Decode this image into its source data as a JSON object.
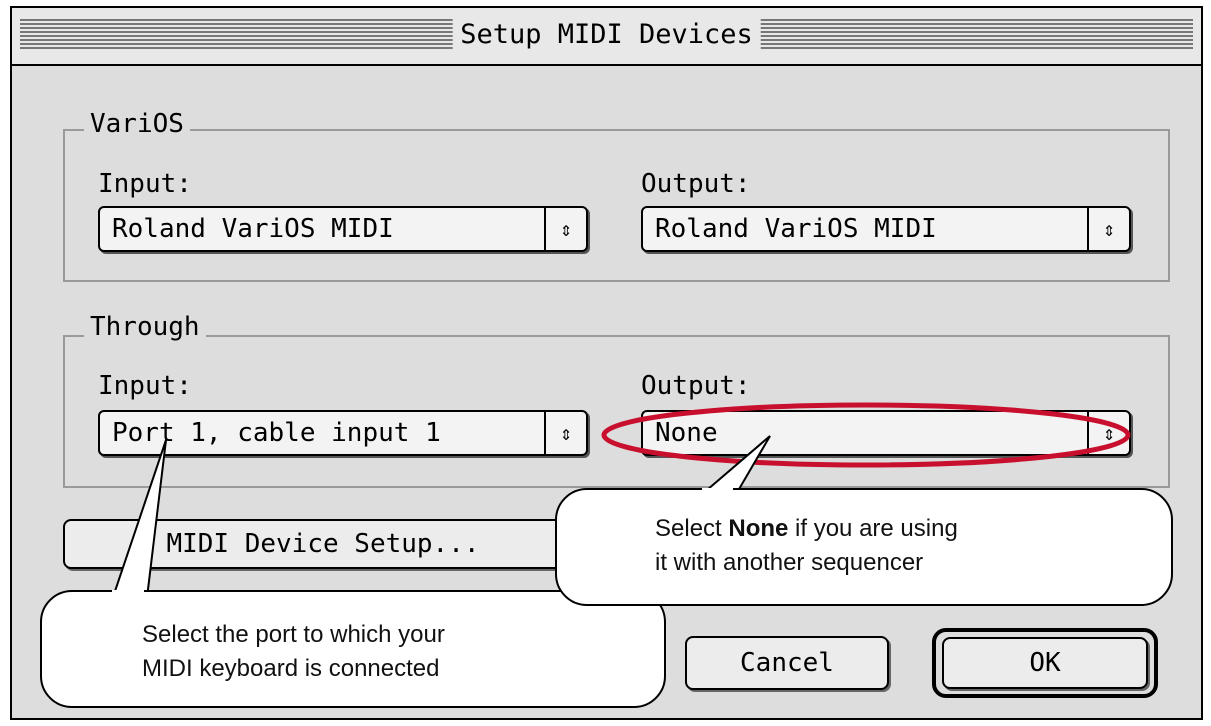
{
  "window": {
    "title": "Setup MIDI Devices"
  },
  "varios": {
    "label": "VariOS",
    "input_label": "Input:",
    "input_value": "Roland VariOS MIDI",
    "output_label": "Output:",
    "output_value": "Roland VariOS MIDI"
  },
  "through": {
    "label": "Through",
    "input_label": "Input:",
    "input_value": "Port  1, cable input 1",
    "output_label": "Output:",
    "output_value": "None"
  },
  "buttons": {
    "device_setup": "MIDI Device Setup...",
    "cancel": "Cancel",
    "ok": "OK"
  },
  "icons": {
    "popup_arrows": "⇕"
  },
  "annotations": {
    "port_line1": "Select the port to which your",
    "port_line2": "MIDI keyboard is connected",
    "none_prefix": "Select ",
    "none_bold": "None",
    "none_suffix": " if you are using",
    "none_line2": "it with another sequencer"
  },
  "colors": {
    "highlight_ellipse": "#c8102e"
  }
}
